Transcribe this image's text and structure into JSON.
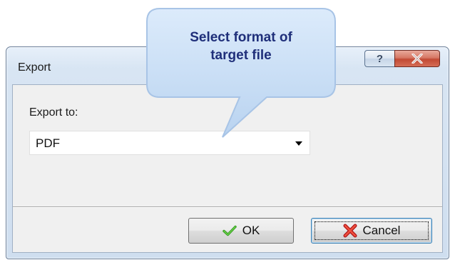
{
  "dialog": {
    "title": "Export",
    "help_symbol": "?",
    "colors": {
      "close_button": "#c24a34",
      "client_background": "#f0f0f0",
      "callout_fill": "#c9dff6",
      "callout_text": "#1f2f7a"
    }
  },
  "callout": {
    "line1": "Select format of",
    "line2": "target file"
  },
  "form": {
    "export_label": "Export to:",
    "format_value": "PDF"
  },
  "buttons": {
    "ok_label": "OK",
    "cancel_label": "Cancel"
  },
  "icons": {
    "help": "help-icon",
    "close": "close-icon",
    "dropdown": "chevron-down-icon",
    "ok": "checkmark-icon",
    "cancel": "red-x-icon"
  }
}
